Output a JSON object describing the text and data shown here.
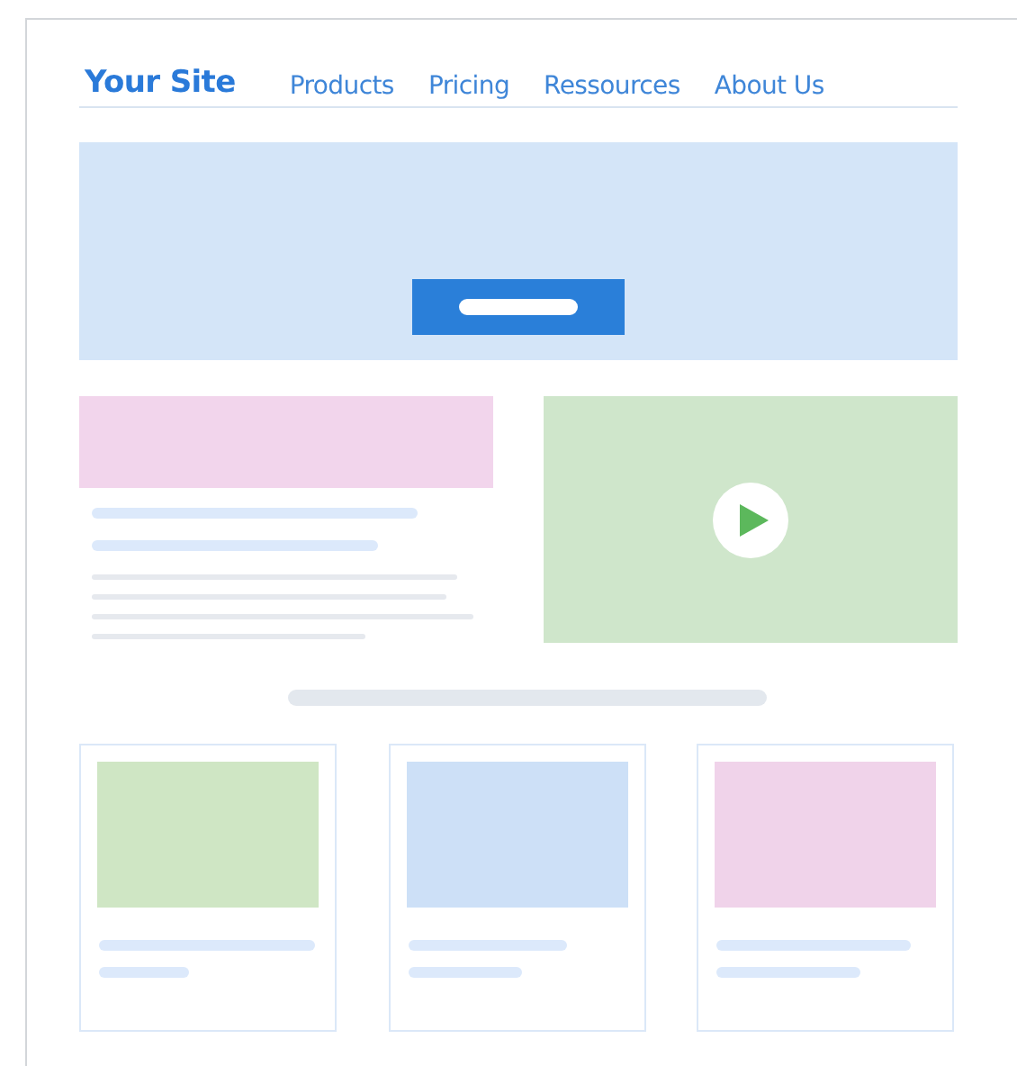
{
  "site_title": "Your Site",
  "nav": [
    {
      "label": "Products"
    },
    {
      "label": "Pricing"
    },
    {
      "label": "Ressources"
    },
    {
      "label": "About Us"
    }
  ],
  "cards": [
    {
      "color": "#cfe6c4"
    },
    {
      "color": "#cde0f7"
    },
    {
      "color": "#f0d3ea"
    }
  ]
}
